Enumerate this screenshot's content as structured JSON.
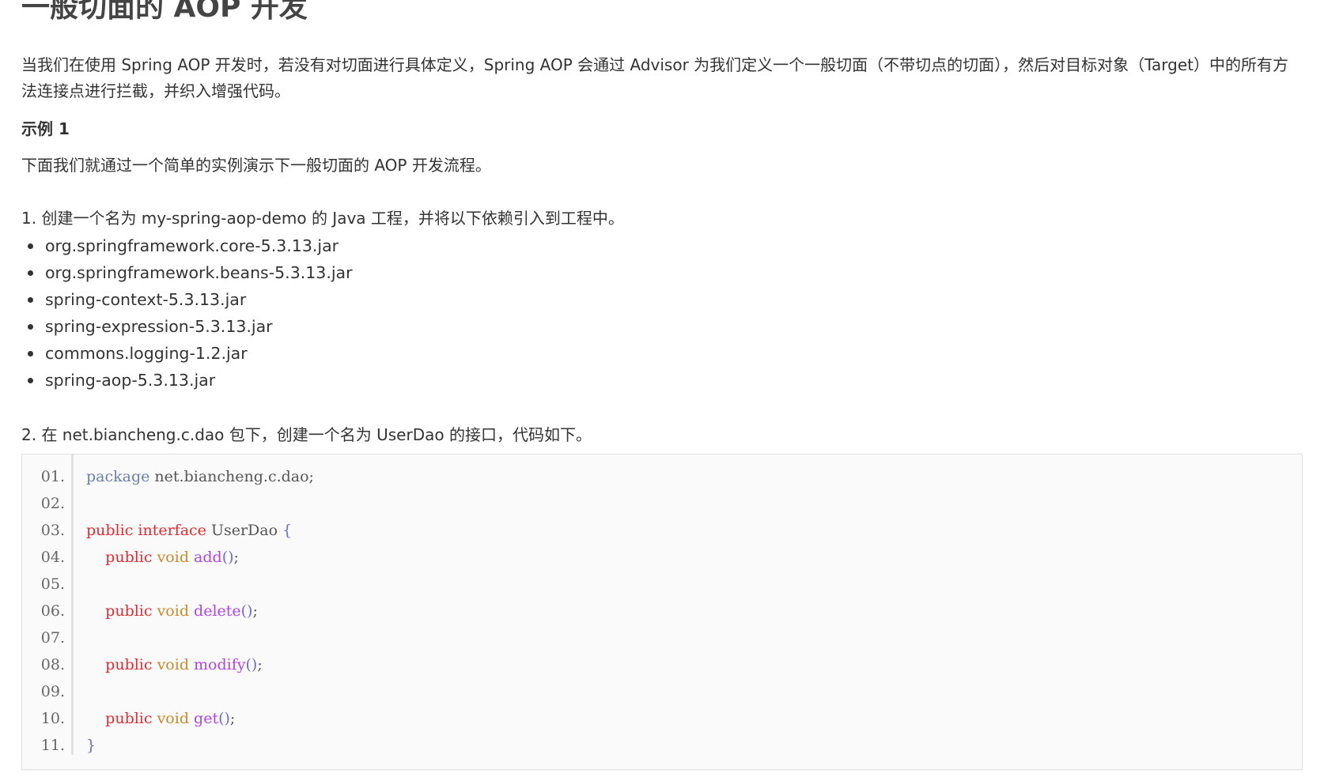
{
  "page": {
    "title": "一般切面的 AOP 开发",
    "intro": "当我们在使用 Spring AOP 开发时，若没有对切面进行具体定义，Spring AOP 会通过 Advisor 为我们定义一个一般切面（不带切点的切面），然后对目标对象（Target）中的所有方法连接点进行拦截，并织入增强代码。",
    "example_heading": "示例 1",
    "example_desc": "下面我们就通过一个简单的实例演示下一般切面的 AOP 开发流程。",
    "step1": "1. 创建一个名为 my-spring-aop-demo 的 Java 工程，并将以下依赖引入到工程中。",
    "dependencies": [
      "org.springframework.core-5.3.13.jar",
      "org.springframework.beans-5.3.13.jar",
      "spring-context-5.3.13.jar",
      "spring-expression-5.3.13.jar",
      "commons.logging-1.2.jar",
      "spring-aop-5.3.13.jar"
    ],
    "step2": "2. 在 net.biancheng.c.dao 包下，创建一个名为 UserDao 的接口，代码如下。"
  },
  "code": {
    "line_numbers": [
      "01.",
      "02.",
      "03.",
      "04.",
      "05.",
      "06.",
      "07.",
      "08.",
      "09.",
      "10.",
      "11."
    ],
    "lines": [
      [
        {
          "t": "package",
          "c": "kw-pkg"
        },
        {
          "t": " net.biancheng.c.dao;",
          "c": "plain"
        }
      ],
      [],
      [
        {
          "t": "public interface",
          "c": "kw-red"
        },
        {
          "t": " UserDao ",
          "c": "plain"
        },
        {
          "t": "{",
          "c": "punct"
        }
      ],
      [
        {
          "t": "    ",
          "c": "plain"
        },
        {
          "t": "public",
          "c": "kw-red"
        },
        {
          "t": " void ",
          "c": "kw-type"
        },
        {
          "t": "add",
          "c": "fn"
        },
        {
          "t": "()",
          "c": "punct"
        },
        {
          "t": ";",
          "c": "plain"
        }
      ],
      [],
      [
        {
          "t": "    ",
          "c": "plain"
        },
        {
          "t": "public",
          "c": "kw-red"
        },
        {
          "t": " void ",
          "c": "kw-type"
        },
        {
          "t": "delete",
          "c": "fn"
        },
        {
          "t": "()",
          "c": "punct"
        },
        {
          "t": ";",
          "c": "plain"
        }
      ],
      [],
      [
        {
          "t": "    ",
          "c": "plain"
        },
        {
          "t": "public",
          "c": "kw-red"
        },
        {
          "t": " void ",
          "c": "kw-type"
        },
        {
          "t": "modify",
          "c": "fn"
        },
        {
          "t": "()",
          "c": "punct"
        },
        {
          "t": ";",
          "c": "plain"
        }
      ],
      [],
      [
        {
          "t": "    ",
          "c": "plain"
        },
        {
          "t": "public",
          "c": "kw-red"
        },
        {
          "t": " void ",
          "c": "kw-type"
        },
        {
          "t": "get",
          "c": "fn"
        },
        {
          "t": "()",
          "c": "punct"
        },
        {
          "t": ";",
          "c": "plain"
        }
      ],
      [
        {
          "t": "}",
          "c": "punct"
        }
      ]
    ]
  }
}
